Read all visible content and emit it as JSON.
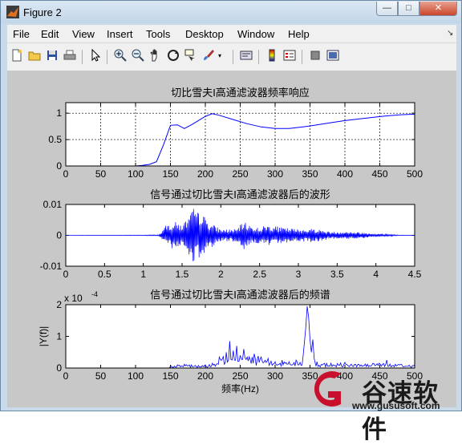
{
  "window": {
    "title": "Figure 2",
    "min_glyph": "—",
    "max_glyph": "□",
    "close_glyph": "✕"
  },
  "menu": [
    "File",
    "Edit",
    "View",
    "Insert",
    "Tools",
    "Desktop",
    "Window",
    "Help"
  ],
  "menu_arrow": "↘",
  "toolbar": [
    "new-figure",
    "open-file",
    "save",
    "print",
    "edit-plot",
    "zoom-in",
    "zoom-out",
    "pan",
    "rotate-3d",
    "data-cursor",
    "brush",
    "link-plot",
    "colorbar",
    "legend",
    "hide-plot-tools",
    "show-plot-tools"
  ],
  "watermark": {
    "text": "谷速软件",
    "url": "www.gususoft.com",
    "color": "#c8102e"
  },
  "colors": {
    "line": "#0000ff",
    "axes_bg": "#ffffff",
    "figure_bg": "#c8c8c8"
  },
  "chart_data": [
    {
      "type": "line",
      "title": "切比雪夫I高通滤波器频率响应",
      "xlim": [
        0,
        500
      ],
      "ylim": [
        0,
        1.2
      ],
      "grid": true,
      "xticks": [
        "0",
        "50",
        "100",
        "150",
        "200",
        "250",
        "300",
        "350",
        "400",
        "450",
        "500"
      ],
      "yticks": [
        "0",
        "0.5",
        "1"
      ],
      "x": [
        0,
        50,
        100,
        110,
        120,
        130,
        140,
        150,
        160,
        170,
        180,
        190,
        200,
        210,
        220,
        240,
        260,
        280,
        300,
        320,
        340,
        360,
        380,
        400,
        420,
        440,
        460,
        480,
        500
      ],
      "y": [
        0,
        0,
        0,
        0.01,
        0.03,
        0.08,
        0.4,
        0.77,
        0.78,
        0.71,
        0.78,
        0.86,
        0.94,
        0.99,
        0.96,
        0.88,
        0.8,
        0.74,
        0.71,
        0.71,
        0.74,
        0.78,
        0.82,
        0.86,
        0.89,
        0.92,
        0.95,
        0.97,
        0.98
      ]
    },
    {
      "type": "line",
      "title": "信号通过切比雪夫I高通滤波器后的波形",
      "xlim": [
        0,
        4.5
      ],
      "ylim": [
        -0.01,
        0.01
      ],
      "grid": false,
      "xticks": [
        "0",
        "0.5",
        "1",
        "1.5",
        "2",
        "2.5",
        "3",
        "3.5",
        "4",
        "4.5"
      ],
      "yticks": [
        "-0.01",
        "0",
        "0.01"
      ],
      "envelope_x": [
        0,
        0.6,
        1.0,
        1.2,
        1.3,
        1.4,
        1.5,
        1.6,
        1.65,
        1.7,
        1.75,
        1.8,
        1.9,
        2.0,
        2.2,
        2.3,
        2.4,
        2.5,
        2.6,
        2.8,
        3.0,
        3.2,
        3.4,
        3.6,
        3.8,
        4.0,
        4.2,
        4.3,
        4.5
      ],
      "envelope_y": [
        0,
        5e-05,
        0.0001,
        0.0002,
        0.0035,
        0.0045,
        0.0035,
        0.0065,
        0.009,
        0.0075,
        0.0085,
        0.0055,
        0.0035,
        0.002,
        0.002,
        0.0045,
        0.003,
        0.0025,
        0.0035,
        0.0025,
        0.002,
        0.0022,
        0.0012,
        0.0012,
        0.001,
        0.0005,
        0.0003,
        0.0001,
        0
      ]
    },
    {
      "type": "line",
      "title": "信号通过切比雪夫I高通滤波器后的频谱",
      "xlim": [
        0,
        500
      ],
      "ylim": [
        0,
        2
      ],
      "grid": false,
      "exponent": "x 10",
      "exponent_power": "-4",
      "xlabel": "频率(Hz)",
      "ylabel": "|Y(f)|",
      "xticks": [
        "0",
        "50",
        "100",
        "150",
        "200",
        "250",
        "300",
        "350",
        "400",
        "450",
        "500"
      ],
      "yticks": [
        "0",
        "1",
        "2"
      ],
      "x": [
        0,
        100,
        140,
        150,
        160,
        170,
        180,
        190,
        200,
        210,
        220,
        230,
        235,
        240,
        245,
        250,
        255,
        260,
        270,
        280,
        290,
        300,
        310,
        320,
        330,
        340,
        342,
        344,
        346,
        348,
        350,
        352,
        354,
        356,
        360,
        380,
        400,
        420,
        440,
        460,
        480,
        500
      ],
      "y": [
        0,
        0,
        0,
        0.06,
        0.1,
        0.12,
        0.1,
        0.08,
        0.1,
        0.15,
        0.35,
        0.5,
        0.85,
        0.55,
        0.7,
        0.4,
        0.6,
        0.35,
        0.45,
        0.35,
        0.3,
        0.2,
        0.25,
        0.2,
        0.25,
        0.35,
        0.8,
        1.3,
        1.95,
        1.6,
        0.9,
        0.5,
        0.9,
        0.3,
        0.2,
        0.15,
        0.18,
        0.12,
        0.15,
        0.25,
        0.12,
        0.1
      ]
    }
  ]
}
